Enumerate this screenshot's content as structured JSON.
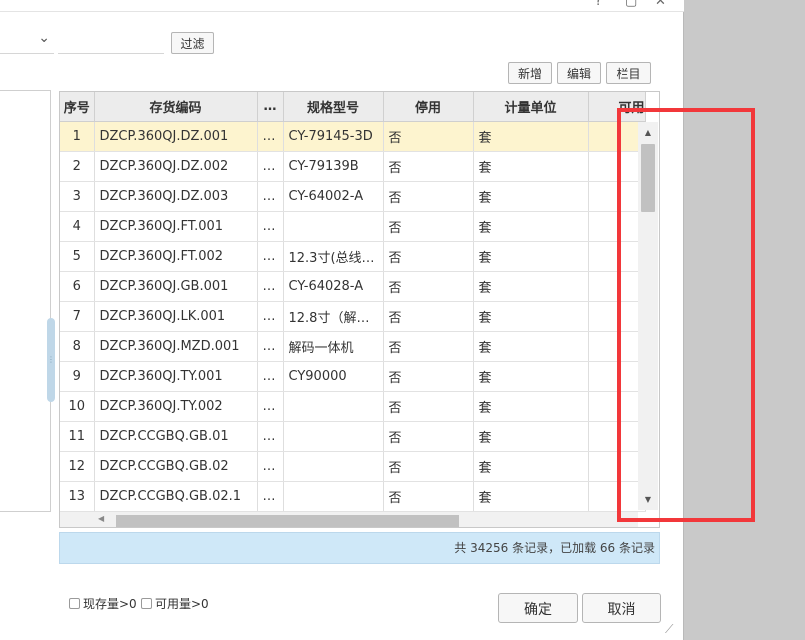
{
  "toolbar": {
    "filter_button": "过滤",
    "add_button": "新增",
    "edit_button": "编辑",
    "columns_button": "栏目"
  },
  "grid": {
    "columns": [
      "序号",
      "存货编码",
      "…",
      "规格型号",
      "停用",
      "计量单位",
      "可用"
    ],
    "rows": [
      {
        "seq": "1",
        "code": "DZCP.360QJ.DZ.001",
        "ell": "…",
        "spec": "CY-79145-3D",
        "stop": "否",
        "unit": "套"
      },
      {
        "seq": "2",
        "code": "DZCP.360QJ.DZ.002",
        "ell": "…",
        "spec": "CY-79139B",
        "stop": "否",
        "unit": "套"
      },
      {
        "seq": "3",
        "code": "DZCP.360QJ.DZ.003",
        "ell": "…",
        "spec": "CY-64002-A",
        "stop": "否",
        "unit": "套"
      },
      {
        "seq": "4",
        "code": "DZCP.360QJ.FT.001",
        "ell": "…",
        "spec": "",
        "stop": "否",
        "unit": "套"
      },
      {
        "seq": "5",
        "code": "DZCP.360QJ.FT.002",
        "ell": "…",
        "spec": "12.3寸(总线…",
        "stop": "否",
        "unit": "套"
      },
      {
        "seq": "6",
        "code": "DZCP.360QJ.GB.001",
        "ell": "…",
        "spec": "CY-64028-A",
        "stop": "否",
        "unit": "套"
      },
      {
        "seq": "7",
        "code": "DZCP.360QJ.LK.001",
        "ell": "…",
        "spec": "12.8寸（解…",
        "stop": "否",
        "unit": "套"
      },
      {
        "seq": "8",
        "code": "DZCP.360QJ.MZD.001",
        "ell": "…",
        "spec": "解码一体机",
        "stop": "否",
        "unit": "套"
      },
      {
        "seq": "9",
        "code": "DZCP.360QJ.TY.001",
        "ell": "…",
        "spec": "CY90000",
        "stop": "否",
        "unit": "套"
      },
      {
        "seq": "10",
        "code": "DZCP.360QJ.TY.002",
        "ell": "…",
        "spec": "",
        "stop": "否",
        "unit": "套"
      },
      {
        "seq": "11",
        "code": "DZCP.CCGBQ.GB.01",
        "ell": "…",
        "spec": "",
        "stop": "否",
        "unit": "套"
      },
      {
        "seq": "12",
        "code": "DZCP.CCGBQ.GB.02",
        "ell": "…",
        "spec": "",
        "stop": "否",
        "unit": "套"
      },
      {
        "seq": "13",
        "code": "DZCP.CCGBQ.GB.02.1",
        "ell": "…",
        "spec": "",
        "stop": "否",
        "unit": "套"
      }
    ]
  },
  "status": {
    "text": "共 34256 条记录，已加载 66 条记录"
  },
  "footer": {
    "checkbox_stock": "现存量>0",
    "checkbox_available": "可用量>0",
    "confirm_button": "确定",
    "cancel_button": "取消"
  },
  "colors": {
    "selected_row": "#fdf4cf",
    "status_bar": "#cfe8f8",
    "highlight_box": "#f2373a"
  }
}
